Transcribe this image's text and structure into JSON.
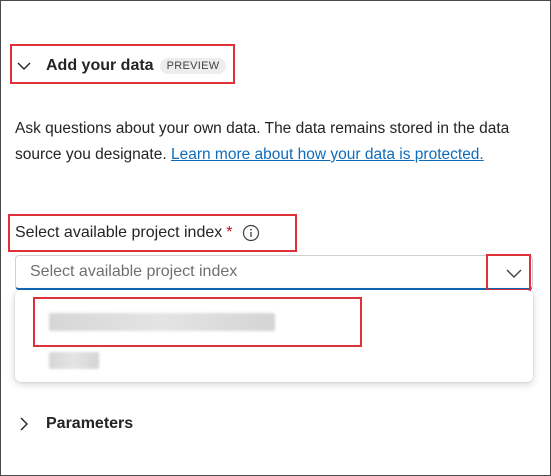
{
  "section": {
    "title": "Add your data",
    "badge": "PREVIEW",
    "description": "Ask questions about your own data. The data remains stored in the data source you designate. ",
    "learn_more_link": "Learn more about how your data is protected."
  },
  "field": {
    "label": "Select available project index",
    "required_marker": "*",
    "placeholder": "Select available project index"
  },
  "dropdown": {
    "options_redacted": 2
  },
  "parameters": {
    "label": "Parameters"
  },
  "colors": {
    "accent": "#0f6cbd",
    "highlight_box": "#e0303a",
    "required": "#c50f1f"
  },
  "icons": {
    "section_toggle": "chevron-down-icon",
    "info": "info-icon",
    "combo": "chevron-down-icon",
    "params_toggle": "chevron-right-icon"
  }
}
